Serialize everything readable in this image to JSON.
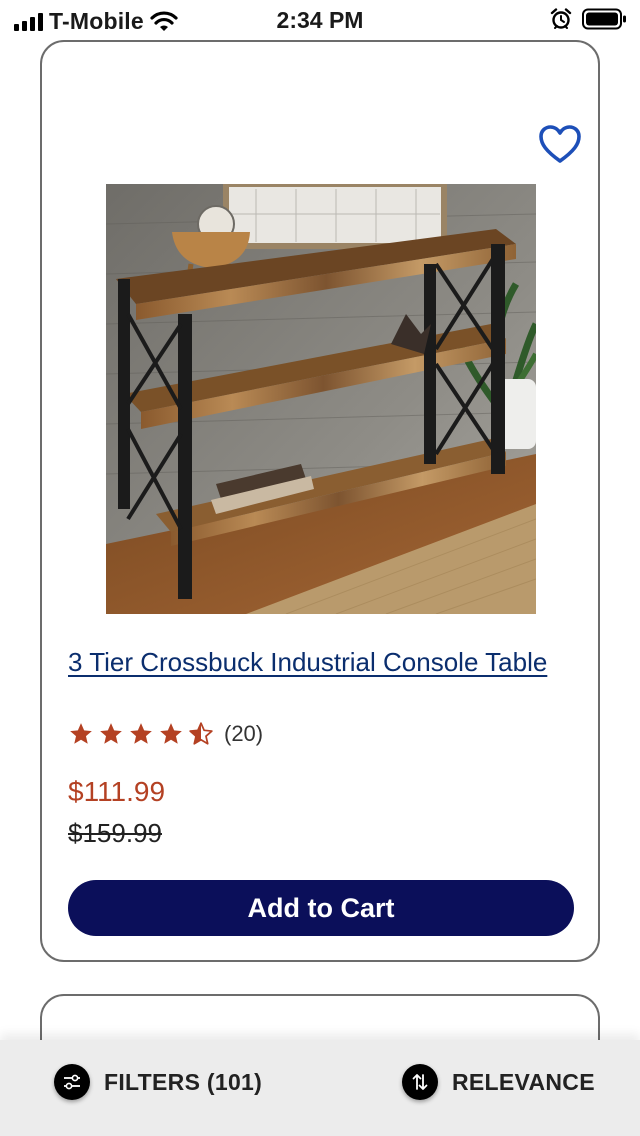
{
  "status_bar": {
    "carrier": "T-Mobile",
    "time": "2:34 PM"
  },
  "product": {
    "title": "3 Tier Crossbuck Industrial Console Table",
    "rating": 4.5,
    "rating_count": "(20)",
    "sale_price": "$111.99",
    "original_price": "$159.99",
    "add_to_cart_label": "Add to Cart",
    "image_icon": "console-table-photo",
    "favorite_icon": "heart-outline-icon"
  },
  "bottom_bar": {
    "filters_label": "FILTERS (101)",
    "sort_label": "RELEVANCE"
  },
  "colors": {
    "accent_dark": "#0b0f5a",
    "link": "#0b2e6e",
    "sale": "#b44123",
    "star": "#b44123",
    "heart": "#1d4fb8"
  }
}
